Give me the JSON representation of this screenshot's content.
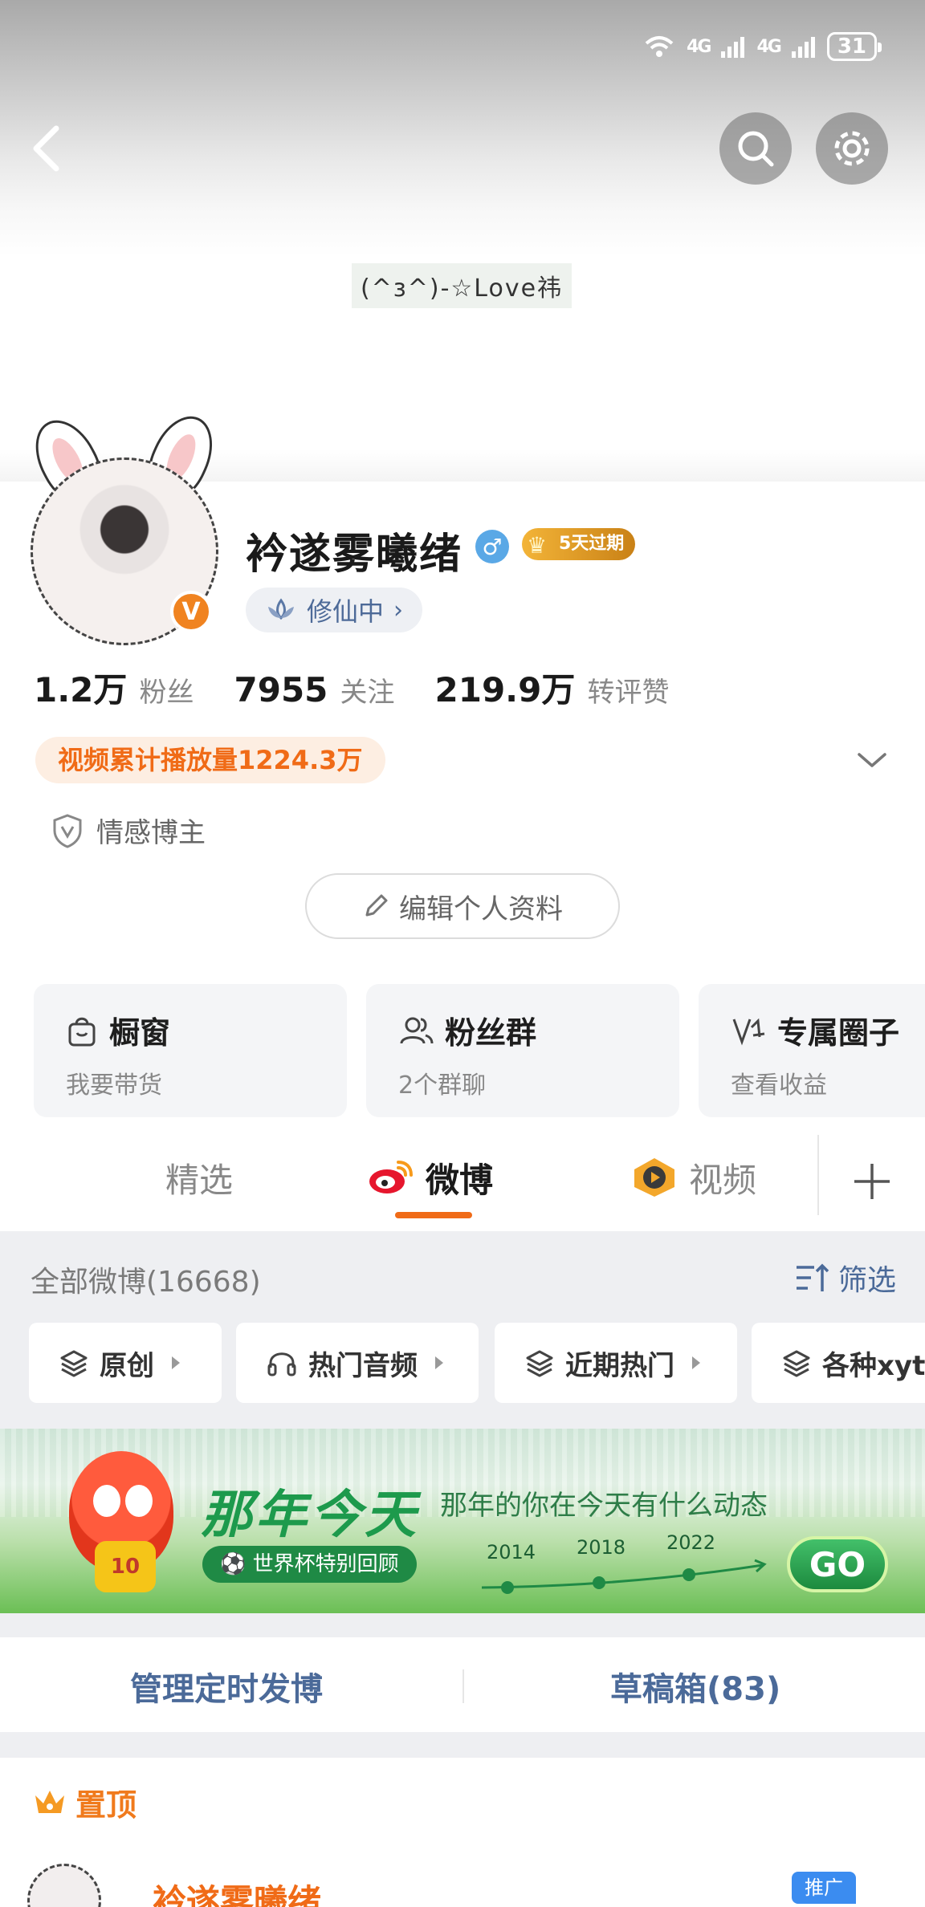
{
  "status_bar": {
    "signal_1": "4G",
    "signal_2": "4G",
    "battery": "31"
  },
  "header": {
    "bio_tag": "(^з^)-☆Love祎"
  },
  "profile": {
    "name": "衿遂雾曦绪",
    "gender_symbol": "♂",
    "vip_badge": "5天过期",
    "status_chip": "修仙中",
    "verified_symbol": "V",
    "stats": [
      {
        "num": "1.2万",
        "label": "粉丝"
      },
      {
        "num": "7955",
        "label": "关注"
      },
      {
        "num": "219.9万",
        "label": "转评赞"
      }
    ],
    "video_plays": "视频累计播放量1224.3万",
    "category": "情感博主",
    "edit_button": "编辑个人资料"
  },
  "cards": [
    {
      "title": "橱窗",
      "sub": "我要带货",
      "icon": "bag-icon"
    },
    {
      "title": "粉丝群",
      "sub": "2个群聊",
      "icon": "group-icon"
    },
    {
      "title": "专属圈子",
      "sub": "查看收益",
      "icon": "circle-icon"
    }
  ],
  "tabs": [
    {
      "label": "精选",
      "active": false
    },
    {
      "label": "微博",
      "active": true
    },
    {
      "label": "视频",
      "active": false
    }
  ],
  "feed": {
    "count_label": "全部微博(16668)",
    "filter_label": "筛选",
    "pills": [
      "原创",
      "热门音频",
      "近期热门",
      "各种xyt"
    ]
  },
  "banner": {
    "title": "那年今天",
    "subtitle": "那年的你在今天有什么动态",
    "tag": "世界杯特别回顾",
    "years": [
      "2014",
      "2018",
      "2022"
    ],
    "go": "GO",
    "mascot_number": "10"
  },
  "actions": {
    "schedule": "管理定时发博",
    "drafts": "草稿箱(83)"
  },
  "pinned": {
    "label": "置顶",
    "post_name": "衿遂雾曦绪",
    "promo": "推广"
  },
  "colors": {
    "accent_orange": "#f06b17",
    "link_blue": "#4b6a99",
    "banner_green": "#1d9a4c"
  }
}
